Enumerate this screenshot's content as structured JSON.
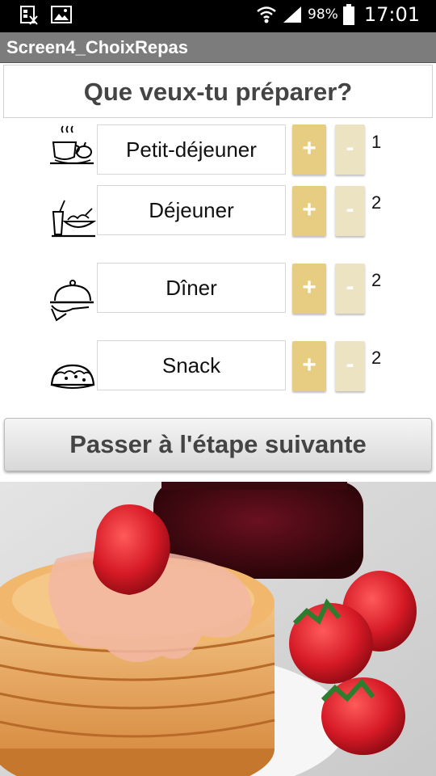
{
  "status_bar": {
    "battery_percent": "98%",
    "time": "17:01",
    "icons": [
      "screenshot-icon",
      "gallery-icon",
      "wifi-icon",
      "signal-icon",
      "battery-icon"
    ]
  },
  "app": {
    "title": "Screen4_ChoixRepas"
  },
  "header": {
    "question": "Que veux-tu préparer?"
  },
  "meals": [
    {
      "label": "Petit-déjeuner",
      "icon": "breakfast-icon",
      "count": "1",
      "plus": "+",
      "minus": "-"
    },
    {
      "label": "Déjeuner",
      "icon": "lunch-icon",
      "count": "2",
      "plus": "+",
      "minus": "-"
    },
    {
      "label": "Dîner",
      "icon": "dinner-cloche-icon",
      "count": "2",
      "plus": "+",
      "minus": "-"
    },
    {
      "label": "Snack",
      "icon": "taco-icon",
      "count": "2",
      "plus": "+",
      "minus": "-"
    }
  ],
  "next_button": {
    "label": "Passer à l'étape suivante"
  },
  "colors": {
    "plus_button": "#e6cd82",
    "minus_button": "#ece3c2",
    "title_bar": "#7c7c7c"
  },
  "image": {
    "subject": "pancakes-with-strawberries"
  }
}
